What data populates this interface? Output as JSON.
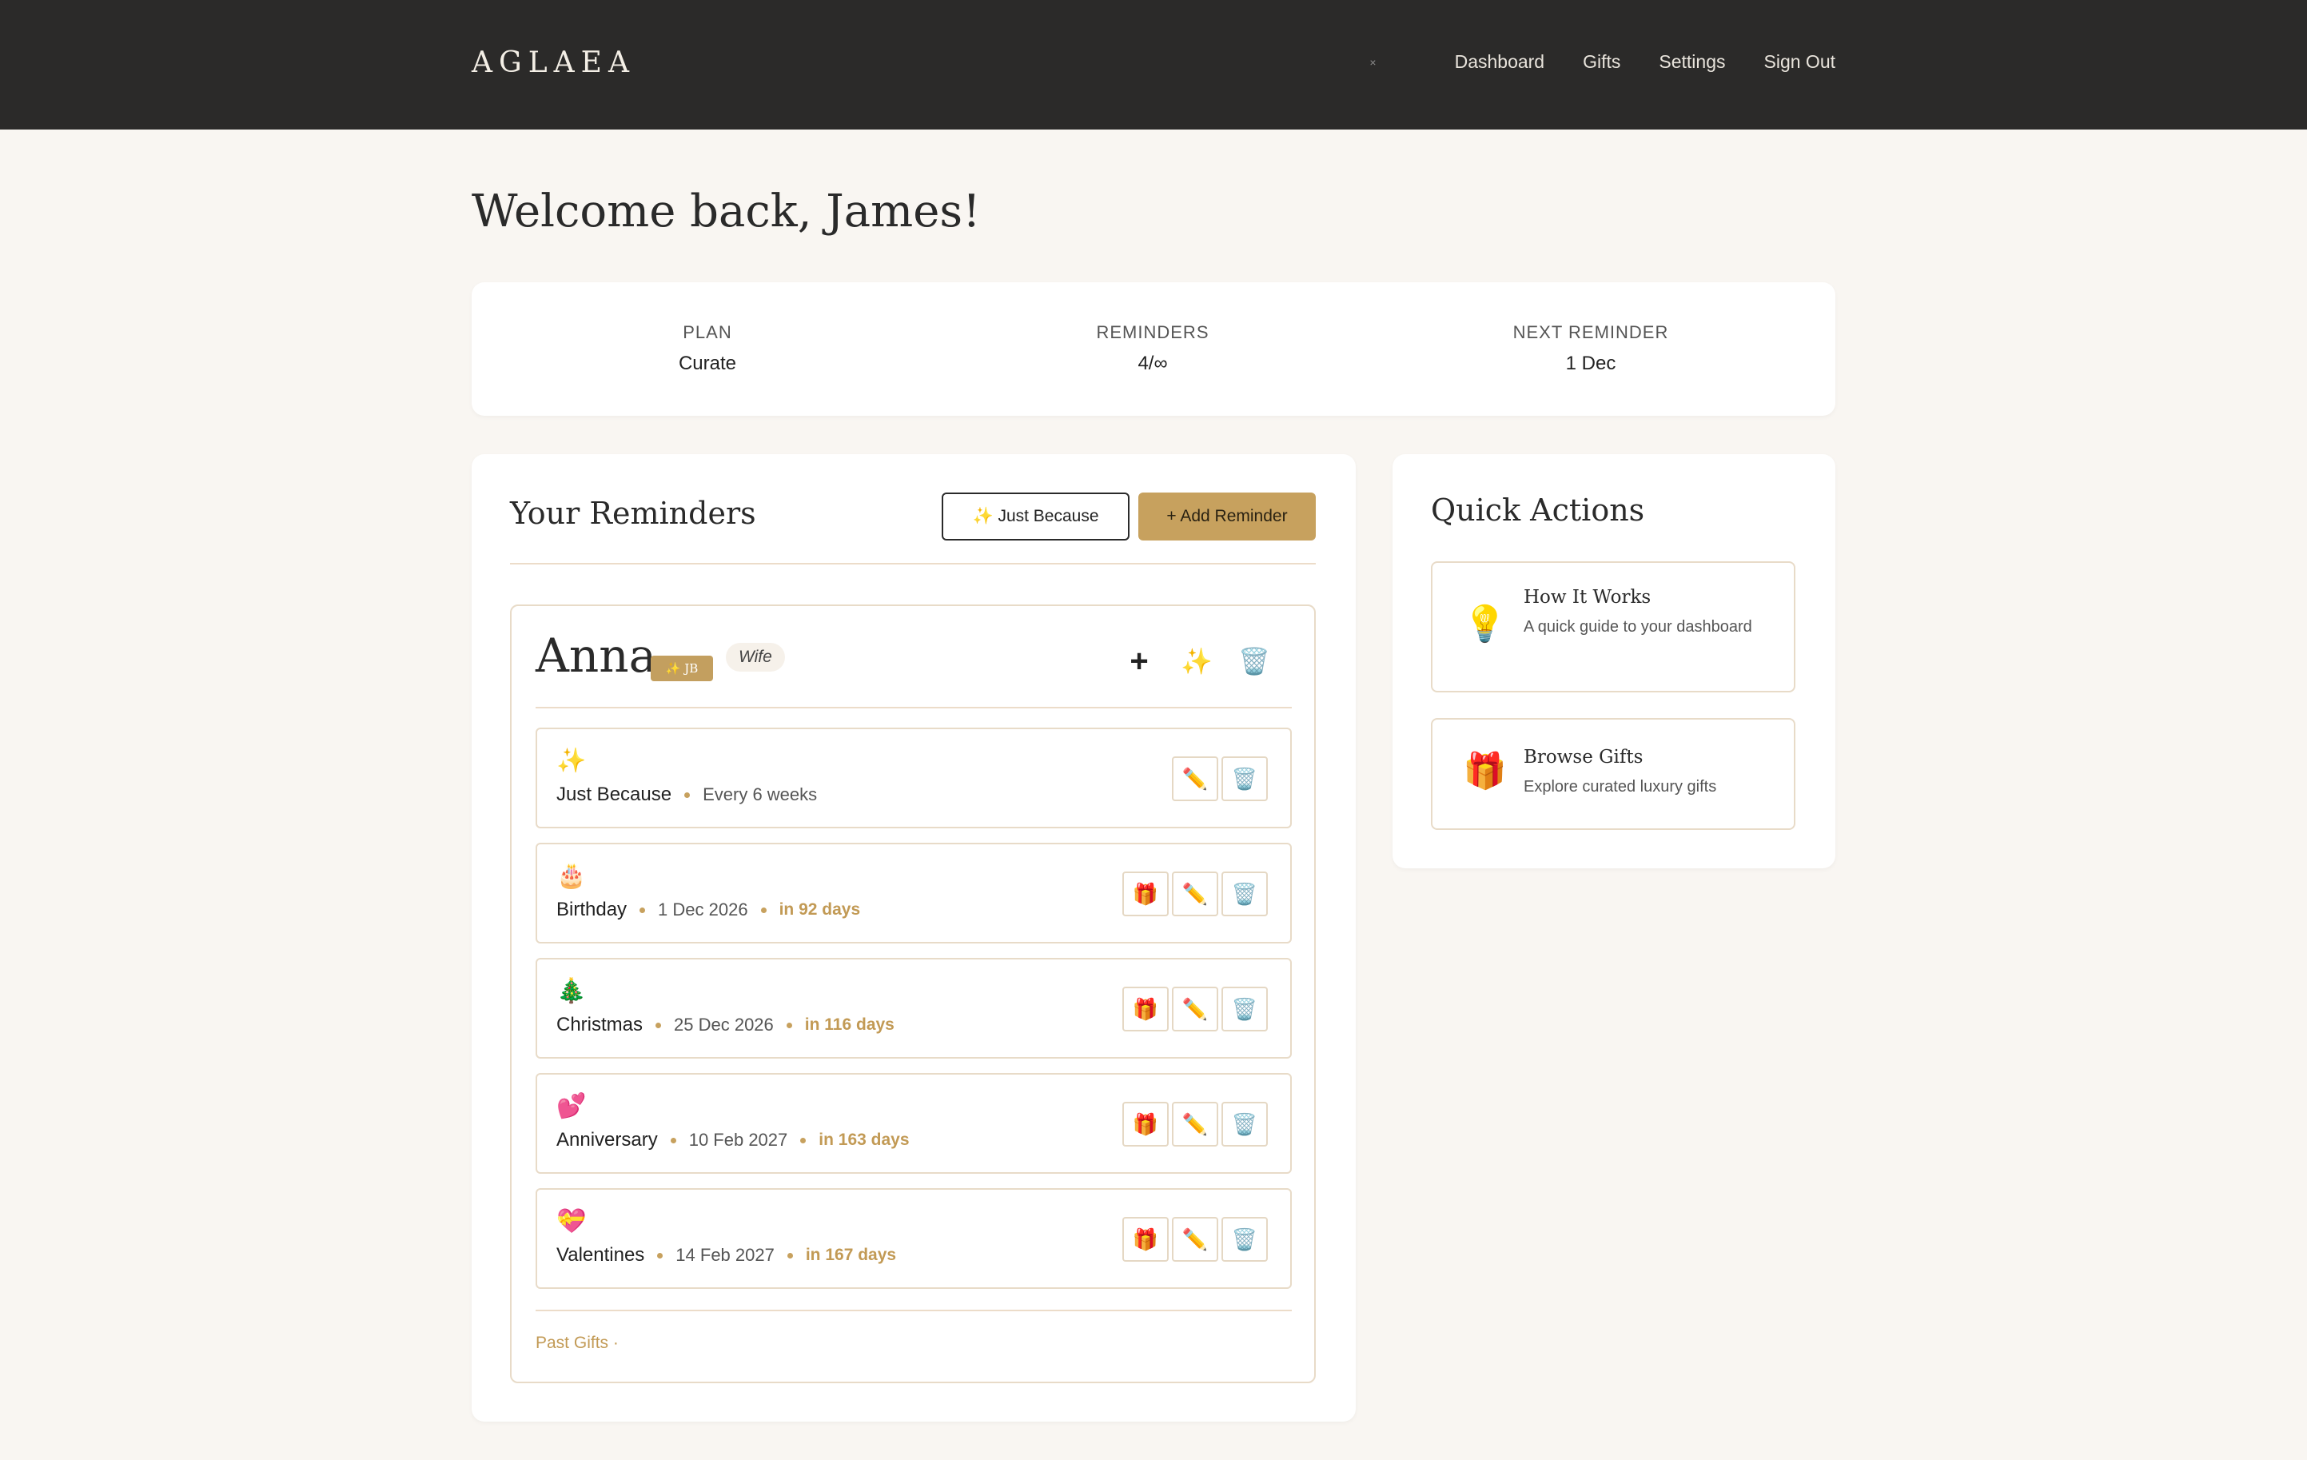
{
  "header": {
    "logo": "AGLAEA",
    "nav_dot": "×",
    "nav": [
      "Dashboard",
      "Gifts",
      "Settings",
      "Sign Out"
    ]
  },
  "welcome": "Welcome back, James!",
  "stats": [
    {
      "label": "PLAN",
      "value": "Curate"
    },
    {
      "label": "REMINDERS",
      "value": "4/∞"
    },
    {
      "label": "NEXT REMINDER",
      "value": "1 Dec"
    }
  ],
  "reminders": {
    "title": "Your Reminders",
    "just_because_label": "✨ Just Because",
    "add_label": "+ Add Reminder",
    "person": {
      "name": "Anna",
      "badge": "✨ JB",
      "relation": "Wife",
      "add_icon": "+",
      "sparkle_icon": "✨",
      "trash_icon": "🗑️",
      "items": [
        {
          "emoji": "✨",
          "name": "Just Because",
          "date": "Every 6 weeks",
          "due": ""
        },
        {
          "emoji": "🎂",
          "name": "Birthday",
          "date": "1 Dec 2026",
          "due": "in 92 days"
        },
        {
          "emoji": "🎄",
          "name": "Christmas",
          "date": "25 Dec 2026",
          "due": "in 116 days"
        },
        {
          "emoji": "💕",
          "name": "Anniversary",
          "date": "10 Feb 2027",
          "due": "in 163 days"
        },
        {
          "emoji": "💝",
          "name": "Valentines",
          "date": "14 Feb 2027",
          "due": "in 167 days"
        }
      ],
      "gift_icon": "🎁",
      "edit_icon": "✏️",
      "past_gifts": "Past Gifts ·"
    }
  },
  "quick_actions": {
    "title": "Quick Actions",
    "items": [
      {
        "icon": "💡",
        "title": "How It Works",
        "desc": "A quick guide to your dashboard"
      },
      {
        "icon": "🎁",
        "title": "Browse Gifts",
        "desc": "Explore curated luxury gifts"
      }
    ]
  }
}
